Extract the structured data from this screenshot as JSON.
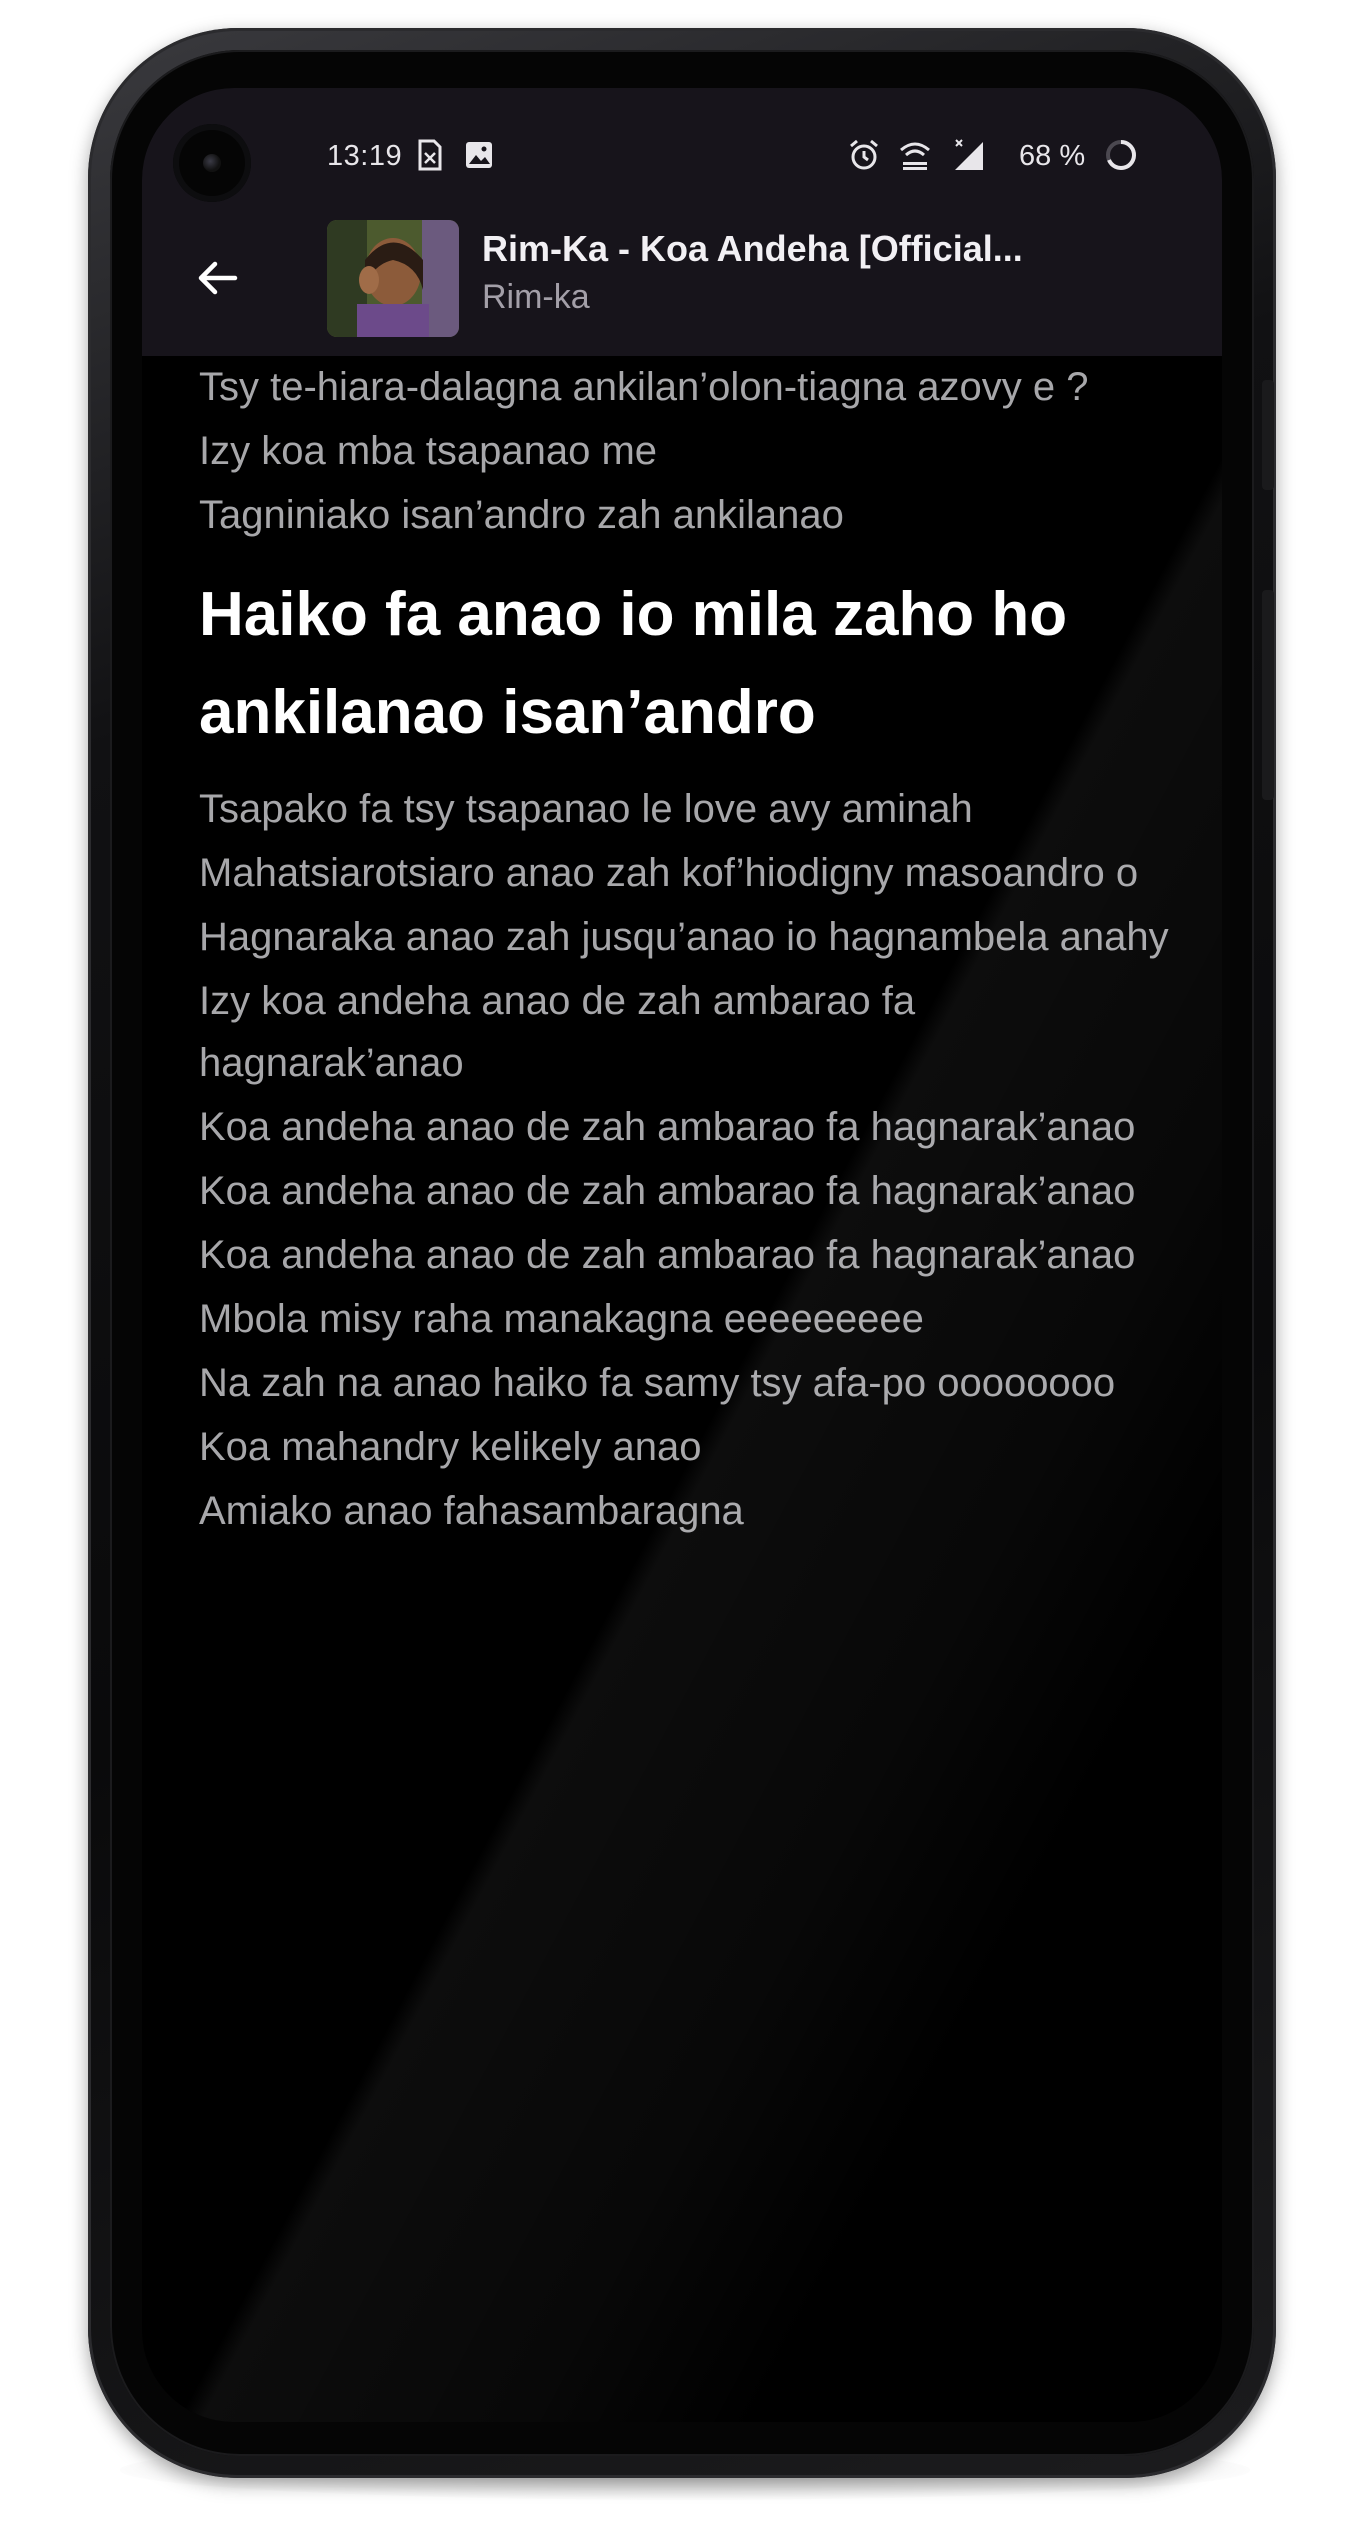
{
  "status_bar": {
    "time": "13:19",
    "battery_percent": "68 %",
    "notification_icons": [
      "sim-card-icon",
      "image-icon"
    ],
    "system_icons": [
      "alarm-icon",
      "wifi-calling-icon",
      "signal-icon",
      "battery-ring-icon"
    ]
  },
  "header": {
    "back_icon": "arrow-left-icon",
    "song_title": "Rim-Ka - Koa Andeha  [Official...",
    "artist": "Rim-ka",
    "colors": {
      "bar_background": "#17141b",
      "title": "#f2f0f4",
      "subtitle": "#a39fa8"
    }
  },
  "lyrics": {
    "current_index": 3,
    "lines": [
      "Tsy te-hiara-dalagna ankilan’olon-tiagna azovy e ?",
      "Izy koa mba tsapanao me",
      "Tagniniako isan’andro zah ankilanao",
      "Haiko fa anao io mila zaho ho ankilanao isan’andro",
      "Tsapako fa tsy tsapanao le love avy aminah",
      "Mahatsiarotsiaro anao zah kof’hiodigny masoandro o",
      "Hagnaraka anao zah jusqu’anao io hagnambela anahy",
      "Izy koa andeha anao de zah ambarao fa hagnarak’anao",
      "Koa andeha anao de zah ambarao fa hagnarak’anao",
      "Koa andeha anao de zah ambarao fa hagnarak’anao",
      "Koa andeha anao de zah ambarao fa hagnarak’anao",
      "Mbola misy raha manakagna eeeeeeeee",
      "Na zah na anao haiko fa samy tsy afa-po oooooooo",
      "Koa mahandry kelikely anao",
      "Amiako anao fahasambaragna"
    ],
    "colors": {
      "inactive": "#a7a7aa",
      "active": "#ffffff",
      "background": "#000000"
    }
  }
}
